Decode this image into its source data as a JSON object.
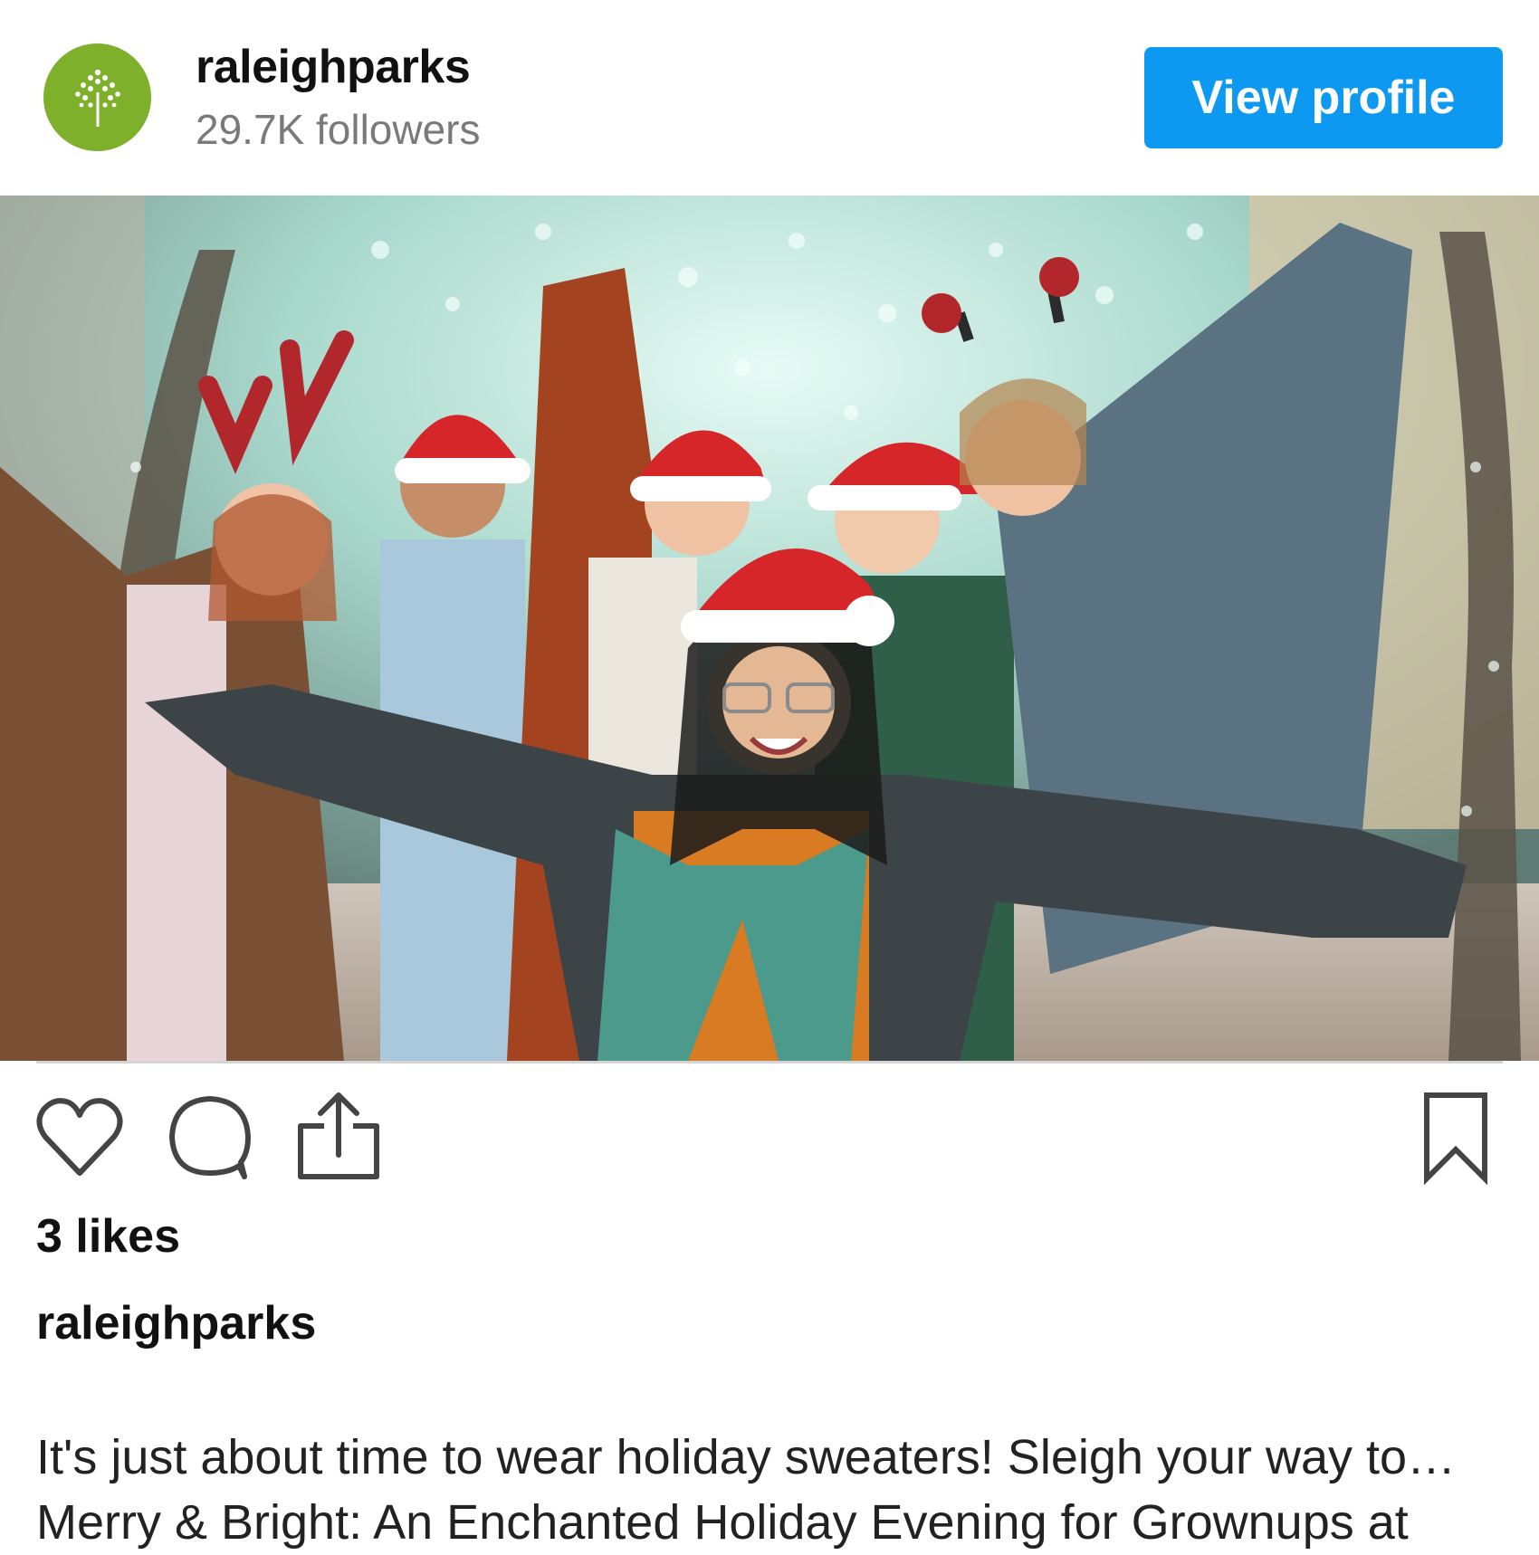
{
  "post": {
    "account": {
      "username": "raleighparks",
      "followers": "29.7K followers",
      "avatar_color": "#7fb02c",
      "avatar_icon": "tree-logo-icon"
    },
    "view_profile_label": "View profile",
    "image": {
      "description_icon": "holiday-group-photo"
    },
    "actions": {
      "like_icon": "heart-icon",
      "comment_icon": "comment-icon",
      "share_icon": "share-icon",
      "save_icon": "bookmark-icon"
    },
    "likes": "3 likes",
    "caption_author": "raleighparks",
    "caption_line1": "It's just about time to wear holiday sweaters! Sleigh your way to…",
    "caption_line2": "Merry & Bright: An Enchanted Holiday Evening for Grownups at"
  },
  "colors": {
    "button_blue": "#0d99f2",
    "muted_text": "#7a7a7a"
  }
}
